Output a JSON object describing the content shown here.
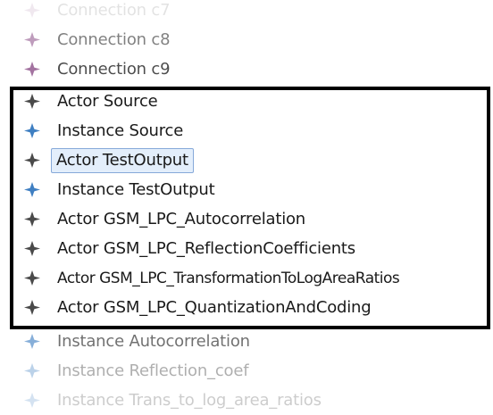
{
  "tree": {
    "items": [
      {
        "label": "Connection c7",
        "kind": "connection",
        "icon": "connection-icon"
      },
      {
        "label": "Connection c8",
        "kind": "connection",
        "icon": "connection-icon"
      },
      {
        "label": "Connection c9",
        "kind": "connection",
        "icon": "connection-icon"
      },
      {
        "label": "Actor Source",
        "kind": "actor",
        "icon": "actor-icon"
      },
      {
        "label": "Instance Source",
        "kind": "instance",
        "icon": "instance-icon"
      },
      {
        "label": "Actor TestOutput",
        "kind": "actor",
        "icon": "actor-icon",
        "selected": true
      },
      {
        "label": "Instance TestOutput",
        "kind": "instance",
        "icon": "instance-icon"
      },
      {
        "label": "Actor GSM_LPC_Autocorrelation",
        "kind": "actor",
        "icon": "actor-icon"
      },
      {
        "label": "Actor GSM_LPC_ReflectionCoefficients",
        "kind": "actor",
        "icon": "actor-icon"
      },
      {
        "label": "Actor GSM_LPC_TransformationToLogAreaRatios",
        "kind": "actor",
        "icon": "actor-icon"
      },
      {
        "label": "Actor GSM_LPC_QuantizationAndCoding",
        "kind": "actor",
        "icon": "actor-icon"
      },
      {
        "label": "Instance Autocorrelation",
        "kind": "instance",
        "icon": "instance-icon"
      },
      {
        "label": "Instance Reflection_coef",
        "kind": "instance",
        "icon": "instance-icon"
      },
      {
        "label": "Instance Trans_to_log_area_ratios",
        "kind": "instance",
        "icon": "instance-icon"
      }
    ]
  },
  "colors": {
    "connection": "#8a4d86",
    "actor": "#4a4a4a",
    "instance": "#3f7fc2",
    "selection_fill": "#e3eefb",
    "selection_border": "#86a9d9",
    "highlight_box": "#000000"
  }
}
